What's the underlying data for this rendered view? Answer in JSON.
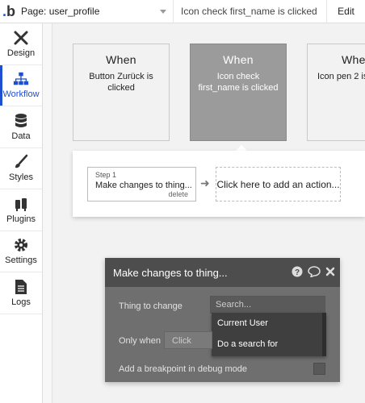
{
  "topbar": {
    "logo": "b",
    "page_select": "Page: user_profile",
    "event_select": "Icon check first_name is clicked",
    "edit_label": "Edit"
  },
  "sidebar": {
    "items": [
      {
        "label": "Design",
        "icon": "design-icon"
      },
      {
        "label": "Workflow",
        "icon": "workflow-icon",
        "active": true
      },
      {
        "label": "Data",
        "icon": "data-icon"
      },
      {
        "label": "Styles",
        "icon": "styles-icon"
      },
      {
        "label": "Plugins",
        "icon": "plugins-icon"
      },
      {
        "label": "Settings",
        "icon": "settings-icon"
      },
      {
        "label": "Logs",
        "icon": "logs-icon"
      }
    ]
  },
  "events": [
    {
      "when": "When",
      "desc": "Button Zurück is clicked"
    },
    {
      "when": "When",
      "desc": "Icon check first_name is clicked",
      "selected": true
    },
    {
      "when": "When",
      "desc": "Icon pen 2 is"
    }
  ],
  "actions": {
    "step_number": "Step 1",
    "step_title": "Make changes to thing...",
    "delete_label": "delete",
    "add_action": "Click here to add an action..."
  },
  "editor": {
    "title": "Make changes to thing...",
    "thing_label": "Thing to change",
    "search_placeholder": "Search...",
    "only_when_label": "Only when",
    "click_placeholder": "Click",
    "breakpoint_label": "Add a breakpoint in debug mode",
    "options": [
      "Current User",
      "Do a search for"
    ]
  },
  "colors": {
    "accent": "#1f4fd1",
    "selected_card": "#9b9b9b",
    "editor_bg": "#6f6f6f",
    "editor_header": "#4d4d4d"
  }
}
